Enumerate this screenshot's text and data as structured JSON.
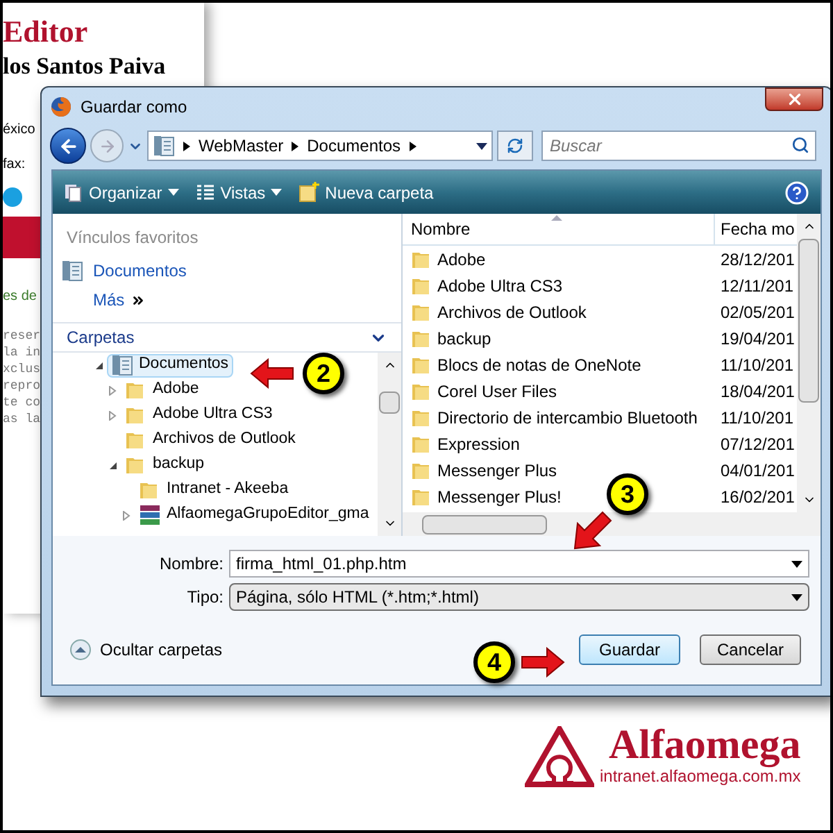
{
  "background_page": {
    "heading": "Editor",
    "subheading": "los Santos Paiva",
    "fragments": [
      {
        "text": "éxico"
      },
      {
        "text": "fax:"
      }
    ],
    "link_fragment": "es de",
    "body_fragments": [
      "reser",
      "la in",
      "xclus",
      "repro",
      "te co",
      "as la"
    ]
  },
  "dialog": {
    "title": "Guardar como",
    "breadcrumb": [
      "WebMaster",
      "Documentos"
    ],
    "search": {
      "placeholder": "Buscar"
    },
    "toolbar": [
      {
        "label": "Organizar",
        "kind": "organize"
      },
      {
        "label": "Vistas",
        "kind": "views"
      },
      {
        "label": "Nueva carpeta",
        "kind": "new-folder"
      }
    ],
    "favorites": {
      "title": "Vínculos favoritos",
      "items": [
        {
          "label": "Documentos"
        }
      ],
      "more": "Más"
    },
    "folders": {
      "title": "Carpetas",
      "tree": [
        {
          "label": "Documentos",
          "kind": "library",
          "selected": true,
          "expanded": true,
          "children": [
            {
              "label": "Adobe",
              "kind": "folder",
              "selected": false,
              "expanded": false
            },
            {
              "label": "Adobe Ultra CS3",
              "kind": "folder",
              "selected": false,
              "expanded": false
            },
            {
              "label": "Archivos de Outlook",
              "kind": "folder",
              "selected": false
            },
            {
              "label": "backup",
              "kind": "folder",
              "selected": false,
              "expanded": true,
              "children": [
                {
                  "label": "Intranet - Akeeba",
                  "kind": "folder",
                  "selected": false
                },
                {
                  "label": "AlfaomegaGrupoEditor_gma",
                  "kind": "archive",
                  "selected": false,
                  "expanded": false
                }
              ]
            }
          ]
        }
      ]
    },
    "file_list": {
      "columns": [
        "Nombre",
        "Fecha mo"
      ],
      "rows": [
        {
          "name": "Adobe",
          "date": "28/12/201"
        },
        {
          "name": "Adobe Ultra CS3",
          "date": "12/11/201"
        },
        {
          "name": "Archivos de Outlook",
          "date": "02/05/201"
        },
        {
          "name": "backup",
          "date": "19/04/201"
        },
        {
          "name": "Blocs de notas de OneNote",
          "date": "11/10/201"
        },
        {
          "name": "Corel User Files",
          "date": "18/04/201"
        },
        {
          "name": "Directorio de intercambio Bluetooth",
          "date": "11/10/201"
        },
        {
          "name": "Expression",
          "date": "07/12/201"
        },
        {
          "name": "Messenger Plus",
          "date": "04/01/201"
        },
        {
          "name": "Messenger Plus!",
          "date": "16/02/201"
        }
      ]
    },
    "fields": [
      {
        "label": "Nombre:",
        "value": "firma_html_01.php.htm",
        "kind": "combo-input"
      },
      {
        "label": "Tipo:",
        "value": "Página, sólo HTML (*.htm;*.html)",
        "kind": "select"
      }
    ],
    "hide_folders": "Ocultar carpetas",
    "buttons": [
      {
        "label": "Guardar",
        "default": true
      },
      {
        "label": "Cancelar",
        "default": false
      }
    ]
  },
  "annotations": [
    {
      "label": "2"
    },
    {
      "label": "3"
    },
    {
      "label": "4"
    }
  ],
  "logo": {
    "name": "Alfaomega",
    "url": "intranet.alfaomega.com.mx"
  }
}
